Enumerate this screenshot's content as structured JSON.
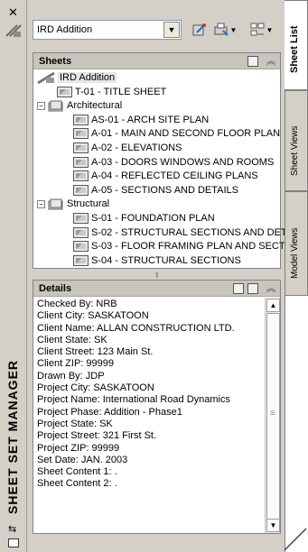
{
  "palette": {
    "window_title": "SHEET SET MANAGER"
  },
  "toolbar": {
    "selected_set": "IRD Addition"
  },
  "sheets_panel": {
    "title": "Sheets",
    "root": "IRD Addition",
    "title_sheet": "T-01 - TITLE SHEET",
    "subsets": [
      {
        "name": "Architectural",
        "items": [
          "AS-01 - ARCH SITE PLAN",
          "A-01 - MAIN AND SECOND FLOOR PLAN",
          "A-02 - ELEVATIONS",
          "A-03 - DOORS WINDOWS AND ROOMS",
          "A-04 - REFLECTED CEILING PLANS",
          "A-05 - SECTIONS AND DETAILS"
        ]
      },
      {
        "name": "Structural",
        "items": [
          "S-01 - FOUNDATION PLAN",
          "S-02 - STRUCTURAL SECTIONS AND DET",
          "S-03 - FLOOR FRAMING PLAN AND SECT",
          "S-04 - STRUCTURAL SECTIONS"
        ]
      }
    ]
  },
  "details_panel": {
    "title": "Details",
    "lines": [
      "Checked By: NRB",
      "Client City: SASKATOON",
      "Client Name: ALLAN CONSTRUCTION LTD.",
      "Client State: SK",
      "Client Street: 123 Main St.",
      "Client ZIP: 99999",
      "Drawn By: JDP",
      "Project City: SASKATOON",
      "Project Name: International Road Dynamics",
      "Project Phase: Addition - Phase1",
      "Project State: SK",
      "Project Street: 321 First St.",
      "Project ZIP: 99999",
      "Set Date: JAN.  2003",
      "Sheet Content 1: .",
      "Sheet Content 2: ."
    ]
  },
  "tabs": {
    "sheet_list": "Sheet List",
    "sheet_views": "Sheet Views",
    "model_views": "Model Views"
  }
}
